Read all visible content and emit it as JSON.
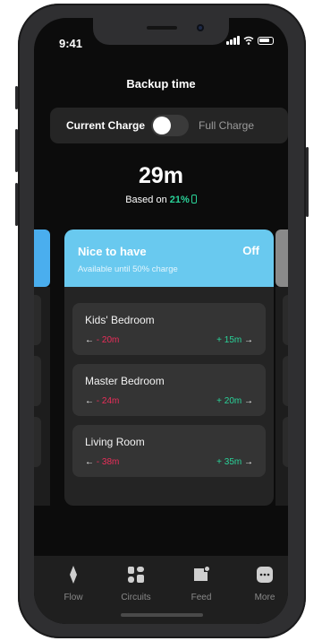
{
  "status_bar": {
    "time": "9:41"
  },
  "header": {
    "title": "Backup time"
  },
  "mode_toggle": {
    "left_label": "Current Charge",
    "right_label": "Full Charge",
    "is_on": false
  },
  "summary": {
    "duration": "29m",
    "based_on_prefix": "Based on",
    "battery_percent": "21%"
  },
  "card": {
    "title": "Nice to have",
    "status": "Off",
    "subtitle": "Available until 50% charge",
    "accent_color": "#69c9ef",
    "rooms": [
      {
        "name": "Kids' Bedroom",
        "decrease": "- 20m",
        "increase": "+ 15m"
      },
      {
        "name": "Master Bedroom",
        "decrease": "- 24m",
        "increase": "+ 20m"
      },
      {
        "name": "Living Room",
        "decrease": "- 38m",
        "increase": "+ 35m"
      }
    ]
  },
  "colors": {
    "negative": "#ea2e5a",
    "positive": "#2ad399",
    "background": "#0c0c0c"
  },
  "tabbar": {
    "tabs": [
      {
        "label": "Flow",
        "icon": "flow-icon"
      },
      {
        "label": "Circuits",
        "icon": "circuits-icon"
      },
      {
        "label": "Feed",
        "icon": "feed-icon"
      },
      {
        "label": "More",
        "icon": "more-icon"
      }
    ]
  }
}
